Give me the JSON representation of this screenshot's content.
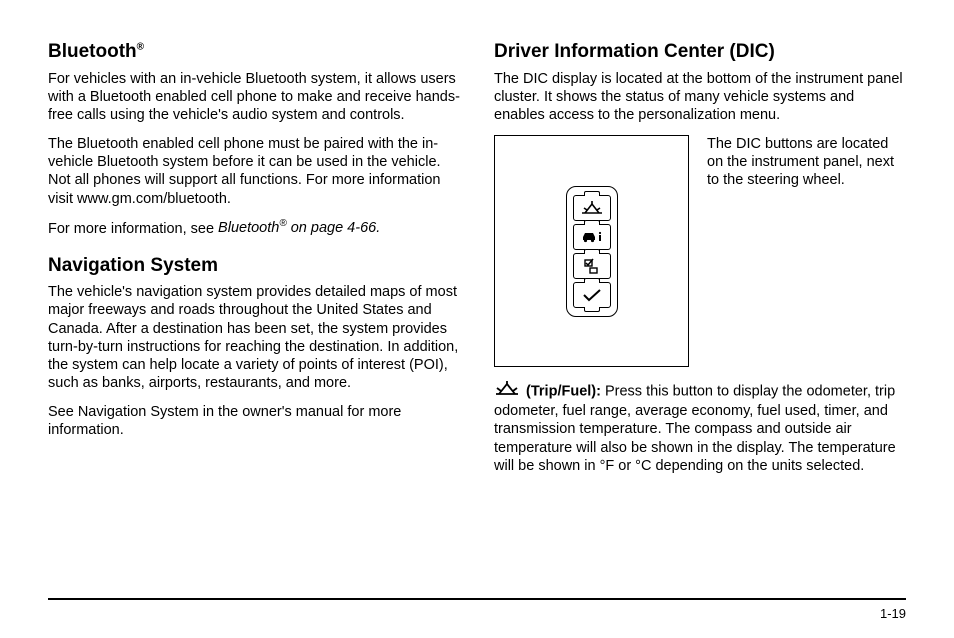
{
  "left": {
    "bluetooth": {
      "heading": "Bluetooth",
      "reg": "®",
      "p1": "For vehicles with an in-vehicle Bluetooth system, it allows users with a Bluetooth enabled cell phone to make and receive hands-free calls using the vehicle's audio system and controls.",
      "p2": "The Bluetooth enabled cell phone must be paired with the in-vehicle Bluetooth system before it can be used in the vehicle. Not all phones will support all functions. For more information visit www.gm.com/bluetooth.",
      "p3_lead": "For more information, see ",
      "p3_ref": "Bluetooth",
      "p3_sup": "®",
      "p3_tail": " on page 4-66."
    },
    "nav": {
      "heading": "Navigation System",
      "p1": "The vehicle's navigation system provides detailed maps of most major freeways and roads throughout the United States and Canada. After a destination has been set, the system provides turn-by-turn instructions for reaching the destination. In addition, the system can help locate a variety of points of interest (POI), such as banks, airports, restaurants, and more.",
      "p2": "See Navigation System in the owner's manual for more information."
    }
  },
  "right": {
    "dic": {
      "heading": "Driver Information Center (DIC)",
      "p1": "The DIC display is located at the bottom of the instrument panel cluster. It shows the status of many vehicle systems and enables access to the personalization menu.",
      "caption": "The DIC buttons are located on the instrument panel, next to the steering wheel.",
      "tripfuel_label": "(Trip/Fuel):",
      "tripfuel_body": " Press this button to display the odometer, trip odometer, fuel range, average economy, fuel used, timer, and transmission temperature. The compass and outside air temperature will also be shown in the display. The temperature will be shown in °F or °C depending on the units selected."
    }
  },
  "page": "1-19"
}
